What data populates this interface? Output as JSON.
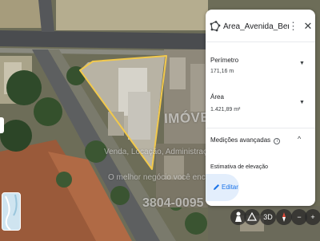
{
  "panel": {
    "title": "Área_Avenida_Benedito",
    "perimeter_label": "Perímetro",
    "perimeter_value": "171,16 m",
    "area_label": "Área",
    "area_value": "1.421,89 m²",
    "advanced_label": "Medições avançadas",
    "elevation_label": "Estimativa de elevação",
    "edit_label": "Editar"
  },
  "watermark": {
    "brand": "IMÓVEIS",
    "tagline": "Venda, Locação, Administração, Avaliação",
    "tagline2": "O melhor negócio você encontra aqui",
    "phone": "3804-0095"
  },
  "map_controls": {
    "view_3d_label": "3D"
  },
  "colors": {
    "polygon_stroke": "#f2c94c",
    "accent": "#1a73e8",
    "panel_bg": "#ffffff"
  },
  "icons": {
    "shape": "polygon-shape-icon",
    "more": "more-vert-icon",
    "close": "close-icon",
    "edit": "pencil-icon",
    "info": "info-icon"
  }
}
